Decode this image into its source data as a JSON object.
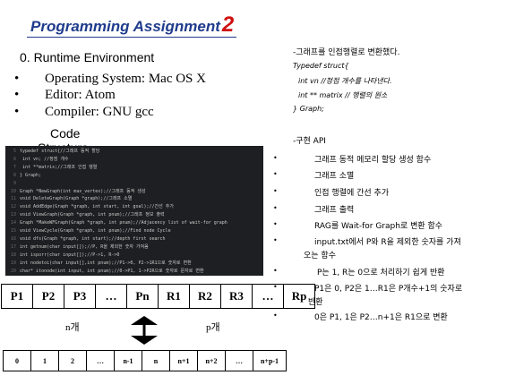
{
  "title": {
    "text": "Programming Assignment",
    "number": "2"
  },
  "env": {
    "heading": "0. Runtime Environment",
    "items": [
      "Operating System: Mac OS X",
      "Editor: Atom",
      "Compiler: GNU gcc"
    ]
  },
  "code": {
    "label": "Code",
    "label_overlap": "Structure",
    "lines": [
      {
        "n": "5",
        "text": "typedef struct{//그래프 동적 할당"
      },
      {
        "n": "6",
        "text": "    int vn; //정점 개수"
      },
      {
        "n": "7",
        "text": "    int **matrix;//그래프 인접 행렬"
      },
      {
        "n": "8",
        "text": "} Graph;"
      },
      {
        "n": "9",
        "text": ""
      },
      {
        "n": "10",
        "text": "Graph *NewGraph(int max_vertex);//그래프 동적 생성"
      },
      {
        "n": "11",
        "text": "void DeleteGraph(Graph *graph);//그래프 소멸"
      },
      {
        "n": "12",
        "text": "void AddEdge(Graph *graph, int start, int goal);//간선 추가"
      },
      {
        "n": "13",
        "text": "void ViewGraph(Graph *graph, int pnum);//그래프 정보 출력"
      },
      {
        "n": "14",
        "text": "Graph *MakeWFGraph(Graph *graph, int pnum);//Adjacency list of wait-for graph"
      },
      {
        "n": "15",
        "text": "void ViewCycle(Graph *graph, int pnum);//Find node Cycle"
      },
      {
        "n": "16",
        "text": "void dfs(Graph *graph, int start);//depth first search"
      },
      {
        "n": "17",
        "text": "int getnum(char input[]);//P, R을 제외한 숫자 가져옴"
      },
      {
        "n": "18",
        "text": "int isporr(char input[]);//P->1, R->0"
      },
      {
        "n": "19",
        "text": "int nodetoi(char input[],int pnum);//P1->0, P2->1R1으로 숫자로 변환"
      },
      {
        "n": "20",
        "text": "char* itonode(int input, int pnum);//0->P1, 1->P2R으로 숫자로 문자로 변환"
      }
    ]
  },
  "graph_desc": {
    "heading": "-그래프를 인접행렬로 변환했다.",
    "code_lines": [
      "Typedef struct{",
      "int vn //정점 개수를 나타낸다.",
      "int ** matrix // 행렬의 원소",
      "} Graph;"
    ]
  },
  "api": {
    "heading": "-구현 API",
    "items": [
      "그래프 동적 메모리 할당 생성 함수",
      "그래프 소멸",
      "인접 행렬에 간선 추가",
      "그래프 출력",
      "RAG를 Wait-for Graph로 변환 함수",
      "input.txt에서 P와 R을 제외한 숫자를 가져",
      "오는 함수",
      "P는 1, R는 0으로 처리하기 쉽게 반환",
      "P1은 0, P2은 1…R1은 P개수+1의 숫자로",
      "반환",
      "0은 P1, 1은 P2…n+1은 R1으로 변환"
    ]
  },
  "array_top": [
    "P1",
    "P2",
    "P3",
    "…",
    "Pn",
    "R1",
    "R2",
    "R3",
    "…",
    "Rp"
  ],
  "array_labels": {
    "left": "n개",
    "right": "p개"
  },
  "array_bottom": [
    "0",
    "1",
    "2",
    "…",
    "n-1",
    "n",
    "n+1",
    "n+2",
    "…",
    "n+p-1"
  ]
}
